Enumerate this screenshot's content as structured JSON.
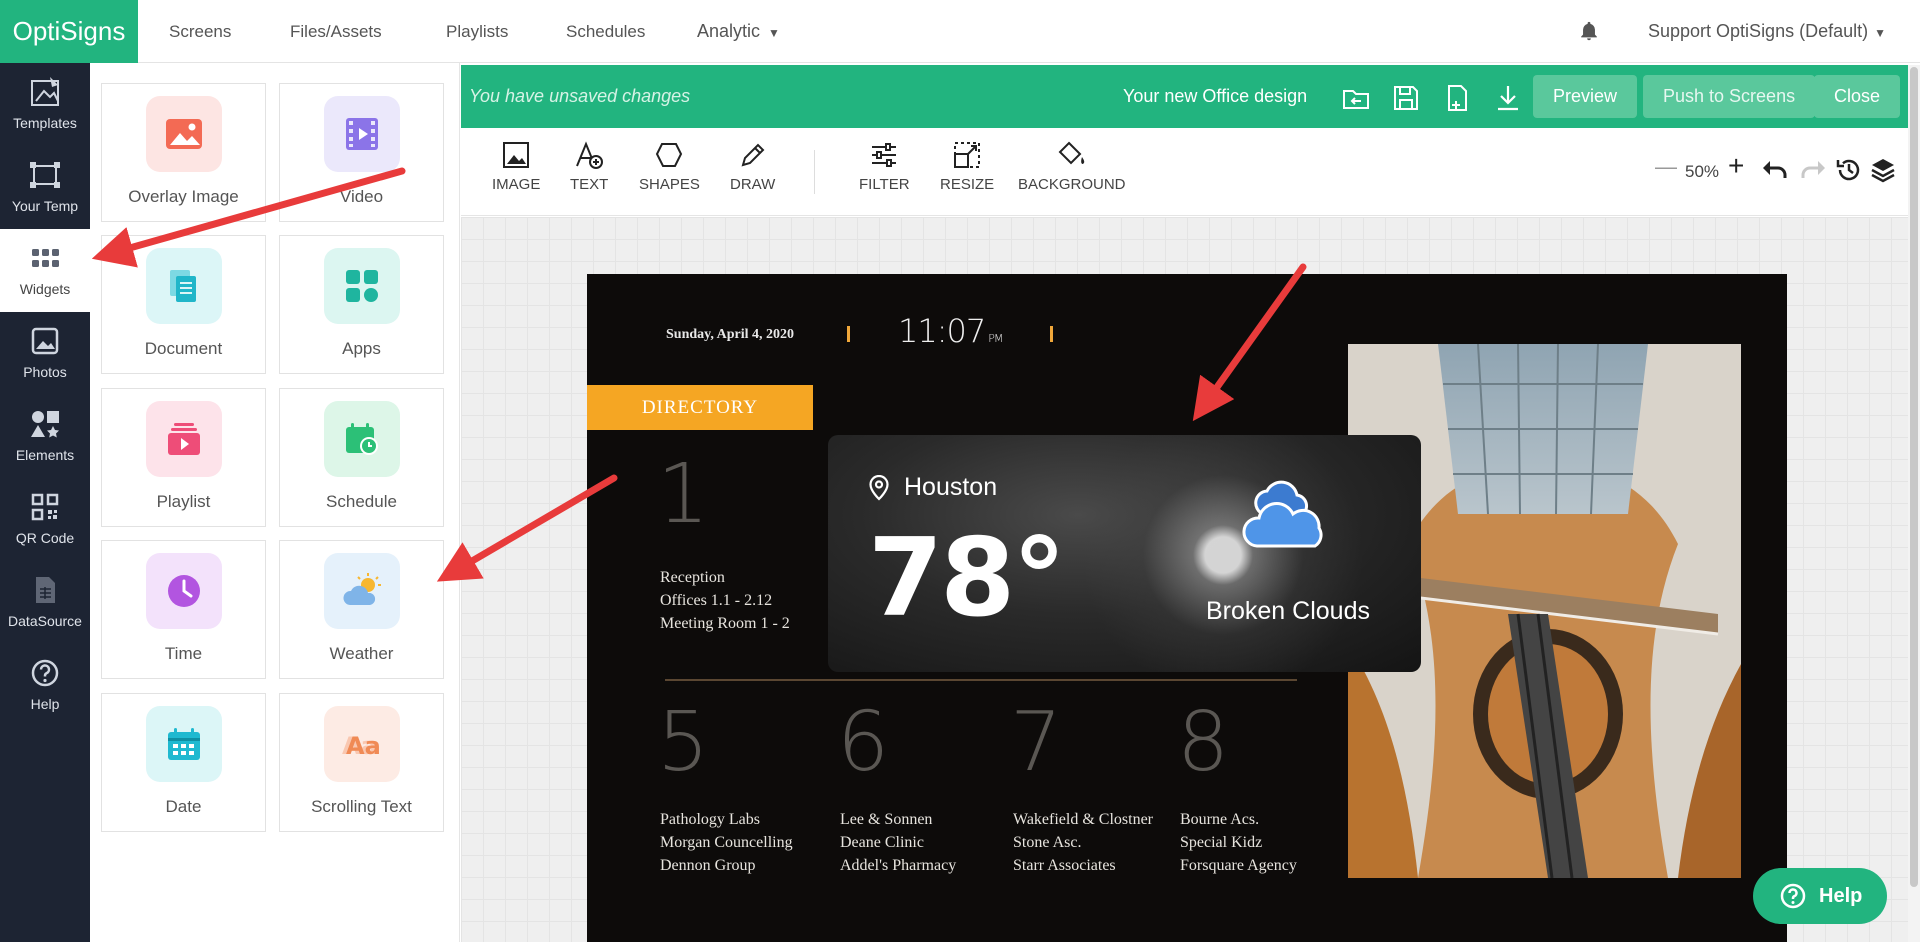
{
  "app": {
    "logo": "OptiSigns"
  },
  "topnav": {
    "links": [
      "Screens",
      "Files/Assets",
      "Playlists",
      "Schedules",
      "Analytic"
    ],
    "account": "Support OptiSigns (Default)"
  },
  "sidebar": {
    "items": [
      {
        "label": "Templates",
        "icon": "templates-icon"
      },
      {
        "label": "Your Temp",
        "icon": "your-templates-icon"
      },
      {
        "label": "Widgets",
        "icon": "widgets-icon"
      },
      {
        "label": "Photos",
        "icon": "photos-icon"
      },
      {
        "label": "Elements",
        "icon": "elements-icon"
      },
      {
        "label": "QR Code",
        "icon": "qr-code-icon"
      },
      {
        "label": "DataSource",
        "icon": "datasource-icon"
      },
      {
        "label": "Help",
        "icon": "help-icon"
      }
    ],
    "active": "Widgets"
  },
  "widgets": [
    {
      "label": "Overlay Image",
      "icon": "overlay-image-icon",
      "color": "#fde5e3"
    },
    {
      "label": "Video",
      "icon": "video-icon",
      "color": "#ebe8fb"
    },
    {
      "label": "Document",
      "icon": "document-icon",
      "color": "#dcf6f7"
    },
    {
      "label": "Apps",
      "icon": "apps-icon",
      "color": "#dcf6f1"
    },
    {
      "label": "Playlist",
      "icon": "playlist-icon",
      "color": "#fde3ea"
    },
    {
      "label": "Schedule",
      "icon": "schedule-icon",
      "color": "#ddf6e8"
    },
    {
      "label": "Time",
      "icon": "time-icon",
      "color": "#f3e2fb"
    },
    {
      "label": "Weather",
      "icon": "weather-icon",
      "color": "#e5f1fb"
    },
    {
      "label": "Date",
      "icon": "date-icon",
      "color": "#dcf6f7"
    },
    {
      "label": "Scrolling Text",
      "icon": "scrolling-text-icon",
      "color": "#fdebe4"
    }
  ],
  "editor": {
    "unsaved": "You have unsaved changes",
    "design_name": "Your new Office design",
    "buttons": {
      "preview": "Preview",
      "push": "Push to Screens",
      "close": "Close"
    },
    "tools": [
      "IMAGE",
      "TEXT",
      "SHAPES",
      "DRAW",
      "FILTER",
      "RESIZE",
      "BACKGROUND"
    ],
    "zoom": "50%"
  },
  "design": {
    "date": "Sunday, April 4, 2020",
    "time": "11:07",
    "ampm": "PM",
    "directory": "DIRECTORY",
    "groups": [
      {
        "num": "1",
        "lines": [
          "Reception",
          "Offices 1.1 - 2.12",
          "Meeting Room 1 - 2"
        ]
      },
      {
        "num": "5",
        "lines": [
          "Pathology Labs",
          "Morgan Councelling",
          "Dennon Group"
        ]
      },
      {
        "num": "6",
        "lines": [
          "Lee & Sonnen",
          "Deane Clinic",
          "Addel's Pharmacy"
        ]
      },
      {
        "num": "7",
        "lines": [
          "Wakefield & Clostner",
          "Stone Asc.",
          "Starr Associates"
        ]
      },
      {
        "num": "8",
        "lines": [
          "Bourne Acs.",
          "Special Kidz",
          "Forsquare Agency"
        ]
      }
    ],
    "weather": {
      "city": "Houston",
      "temp": "78°",
      "condition": "Broken Clouds"
    }
  },
  "help_button": "Help",
  "colors": {
    "brand": "#22b47f",
    "sidebar": "#1d2433",
    "accent": "#f5a623",
    "arrow": "#e83b3b"
  }
}
